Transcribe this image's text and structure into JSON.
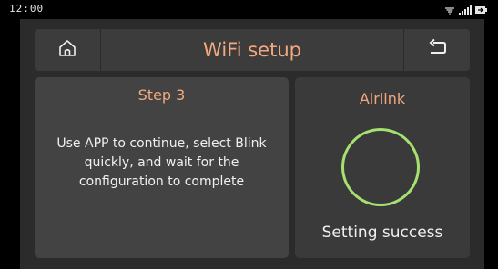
{
  "status_bar": {
    "time": "12:00",
    "icons": [
      "wifi-icon",
      "signal-icon",
      "battery-icon"
    ]
  },
  "header": {
    "title": "WiFi setup",
    "home_icon": "home-icon",
    "back_icon": "back-arrow-icon"
  },
  "step_panel": {
    "title": "Step 3",
    "instructions": "Use APP to continue, select Blink quickly, and wait for the configuration to complete"
  },
  "airlink_panel": {
    "title": "Airlink",
    "progress_ring_icon": "progress-ring",
    "status": "Setting success"
  },
  "colors": {
    "accent": "#f2a97e",
    "success_ring": "#a6e070",
    "panel": "#434343",
    "header": "#3c3c3c",
    "screen": "#2b2b2b",
    "text": "#f0f0f0"
  }
}
